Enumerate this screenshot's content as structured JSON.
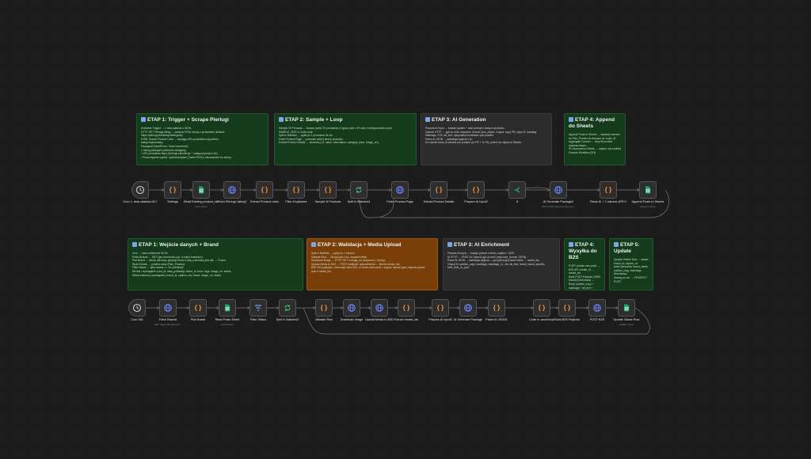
{
  "row1_notes": [
    {
      "title": "ETAP 1: Trigger + Scrape Plerlugi",
      "color": "green",
      "lines": [
        "Schedule Trigger → 1 dnia zdadzia o 06:00.",
        "HTTP GET Plerlugi listing → pobiera HTML strony z produktami (default:",
        "https://plerlugi.pl/kolekcje/kategoria)",
        "HTML Extract Product Links → wyciąga URL produktów wg pattern,",
        "kategoria/produkty.",
        "Paraagraf (WordPress / WooCommerce):",
        "• Listing (kategorii publicznie dostępny)",
        "• URL produktów https://plerlugi.pl/kolekcje + category/product (fn)",
        "• Poszczególne wyniki / opis/description (Tweet RSS) z linkowaniem do strony"
      ]
    },
    {
      "title": "ETAP 2: Sample + Loop",
      "color": "green",
      "lines": [
        "Sample 20 Products → losowy wybór 20 produktów (Crypto) (slot z 20 slot). Konfigurowalne przez",
        "SAMPLE_SIZE w Code node.",
        "Split In Batches → pętla po 1 produkcie na raz.",
        "Fetch Product Page → pobranie pełnej strony produktu.",
        "Extract Product Details → struktura { id, name, description, category, price, image_url }"
      ]
    },
    {
      "title": "ETAP 3: AI Generation",
      "color": "gray",
      "lines": [
        "Prepare AI Input → buduje system + user prompt z danych produktu.",
        "OpenAI HTTP → gpt-4o-mini, response_format: json_object. Output: copy PR, copy IG, hashtag,",
        "hashtags, CTA, alt_text, opcjonalny komentarz pod postem.",
        "Parse AI JSON → walidacja wyjścia z AI.",
        "Do sciezki trzeci (5 sekund per produkt (1x PR + 1x IG), potem do zapisu w Sheets."
      ]
    },
    {
      "title": "ETAP 4: Append do Sheets",
      "color": "green",
      "lines": [
        "Append Posts to Sheets → dopisuje wiersze",
        "do Plan_Postow do arkusza np. kopii_01",
        "Aggregate Counter → liczy ile postów",
        "wygenerowano.",
        "Po ukończeniu Sheets → zaplan. się workflow 3",
        "Execute Workflow (3/3)"
      ]
    }
  ],
  "row2_notes": [
    {
      "title": "ETAP 1: Wejście danych + Brand",
      "color": "green",
      "lines": [
        "Cron → start codziennie 06:00.",
        "Fetch Brands → GET (get-all brands) (np. w wielu brandach).",
        "Pick Brand → bierze pierwszy (jedyny) brand z listy, potrzebny jest dla: → Promo.",
        "Read Sheets → pobiera dane (Plan_Postow).",
        "Filter Status → tylko status == 'Do publikacji'.",
        "Sheets / wymaganie: post_id, data_publikacji, brand_id, tresc, tags, image_url, status.",
        "Status kolumny (wymagane): brand_id, caption, cta, brand, image_url, status"
      ]
    },
    {
      "title": "ETAP 2: Walidacja + Media Upload",
      "color": "brown",
      "lines": [
        "Split In Batches → pętla po 1 wierszu.",
        "Validate Row → Strzał pośl z kol. required fields.",
        "Download Image → HTTP GET z image_url (response = binary).",
        "Upload Media to B2D → POST multipart, upload/media → bielmo media_ids.",
        "B2D Vid podpięcie, zobrazuje input URL, tr zmian scew post = zajęcie upload (plus, depusc piszac",
        "post z media_ids."
      ]
    },
    {
      "title": "ETAP 3: AI Enrichment",
      "color": "gray",
      "lines": [
        "Prepare AI Input → buduje prompt z tresci, caption + B2S.",
        "AI HTTP → POST do OpenAI gpt-4o-mini (response_format: JSON).",
        "Parse AI JSON → walidacja wyjścia — (prz)(through) brand fields → media_ids.",
        "Output AI: publish_copy, hashtags, hashtags_LL, cta, alt_text, brand_visual_specific,",
        "best_time_to_post."
      ]
    },
    {
      "title": "ETAP 4: Wysyłka do B2S",
      "color": "green",
      "lines": [
        "POST (create new post) →",
        "B2S API /create_v1 →",
        "media_ids",
        "Build POST Payload (JSON",
        "brand)/(Scheduled) →",
        "Body: publish_copy +",
        "hashtags + alt_text +",
        "brand_id + media_ids (=",
        "optionally",
        "scheduled_at/now)"
      ]
    },
    {
      "title": "ETAP 5: Update",
      "color": "green",
      "lines": [
        "Update Sheets Row → status,",
        "brand_id, caption_id,",
        "bzasi (forwards: brand_name,",
        "publish_copy, hashtags,",
        "timestamp).",
        "Statuty po zm. → PRIORITY",
        "POST."
      ]
    }
  ],
  "row1_nodes": [
    {
      "label": "Cron 1: dnia zdadzia 06:?",
      "sub": "",
      "icon": "clock-icon"
    },
    {
      "label": "Settings",
      "sub": "",
      "icon": "code-icon"
    },
    {
      "label": "Read Existing product_ids",
      "sub": "read: sheet",
      "icon": "sheets-icon"
    },
    {
      "label": "Fetch Plerlugi Listing?",
      "sub": "",
      "icon": "globe-icon"
    },
    {
      "label": "Extract Product Links",
      "sub": "",
      "icon": "code-icon"
    },
    {
      "label": "Filter Duplicates",
      "sub": "",
      "icon": "code-icon"
    },
    {
      "label": "Sample N Products",
      "sub": "",
      "icon": "code-icon"
    },
    {
      "label": "Split In Batches3",
      "sub": "",
      "icon": "loop-icon"
    },
    {
      "label": "Fetch Product Page",
      "sub": "",
      "icon": "globe-icon"
    },
    {
      "label": "Extract Product Details",
      "sub": "",
      "icon": "code-icon"
    },
    {
      "label": "Prepare AI Input2",
      "sub": "",
      "icon": "code-icon"
    },
    {
      "label": "If",
      "sub": "",
      "icon": "if-icon"
    },
    {
      "label": "AI Generate Package2",
      "sub": "POST: https://api.openai.com/...",
      "icon": "globe-icon"
    },
    {
      "label": "Parse AI + 2 wiersze (PR+IG)",
      "sub": "",
      "icon": "code-icon"
    },
    {
      "label": "Append Posts to Sheets",
      "sub": "append: sheet",
      "icon": "sheets-icon"
    }
  ],
  "row2_nodes": [
    {
      "label": "Cron 061",
      "sub": "",
      "icon": "clock-icon"
    },
    {
      "label": "Fetch Brands",
      "sub": "GET: https://api.brand.fr/...",
      "icon": "globe-icon"
    },
    {
      "label": "Pick Brand",
      "sub": "",
      "icon": "code-icon"
    },
    {
      "label": "Read Posts Sheet",
      "sub": "read: sheet",
      "icon": "sheets-icon"
    },
    {
      "label": "Filter Status",
      "sub": "",
      "icon": "filter-icon"
    },
    {
      "label": "Split In Batches3",
      "sub": "",
      "icon": "loop-icon"
    },
    {
      "label": "Validate Row",
      "sub": "",
      "icon": "code-icon"
    },
    {
      "label": "Download Image",
      "sub": "",
      "icon": "globe-icon"
    },
    {
      "label": "Upload Media to B2D",
      "sub": "",
      "icon": "globe-icon"
    },
    {
      "label": "Extract media_ids",
      "sub": "",
      "icon": "code-icon"
    },
    {
      "label": "Prepare AI Input2",
      "sub": "",
      "icon": "code-icon"
    },
    {
      "label": "AI Generate Package",
      "sub": "",
      "icon": "globe-icon"
    },
    {
      "label": "Parse AI JSON1",
      "sub": "",
      "icon": "code-icon"
    },
    {
      "label": "Code in JavaScript",
      "sub": "",
      "icon": "code-icon"
    },
    {
      "label": "Build B2S Payload",
      "sub": "",
      "icon": "code-icon"
    },
    {
      "label": "POST B2S",
      "sub": "",
      "icon": "globe-icon"
    },
    {
      "label": "Update Status Row",
      "sub": "update: sheet",
      "icon": "sheets-icon"
    }
  ],
  "colors": {
    "bg": "#1c1c1c",
    "edge": "#7a7a7a",
    "code": "#ff9b3d",
    "globe": "#6f8cff",
    "sheets": "#1fa463",
    "loop": "#3ec277",
    "if": "#3ec277",
    "filter": "#6ea8ff"
  }
}
